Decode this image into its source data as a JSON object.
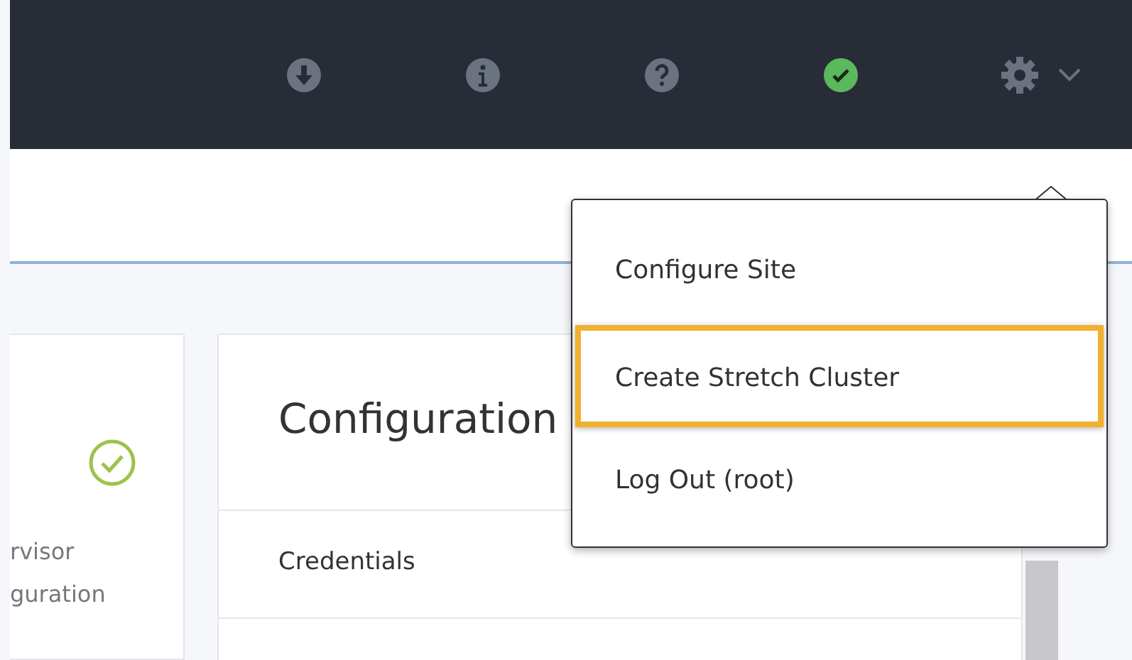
{
  "toolbar": {
    "icons": [
      {
        "kind": "download"
      },
      {
        "kind": "info"
      },
      {
        "kind": "help"
      },
      {
        "kind": "status"
      },
      {
        "kind": "settings"
      }
    ]
  },
  "user_menu": {
    "items": [
      {
        "label": "Configure Site",
        "selected": false
      },
      {
        "label": "Create Stretch Cluster",
        "selected": true
      },
      {
        "label": "Log Out (root)",
        "selected": false
      }
    ]
  },
  "left_card": {
    "lines": [
      "rvisor",
      "guration"
    ]
  },
  "config_card": {
    "title": "Configuration",
    "rows": [
      "Credentials"
    ]
  }
}
